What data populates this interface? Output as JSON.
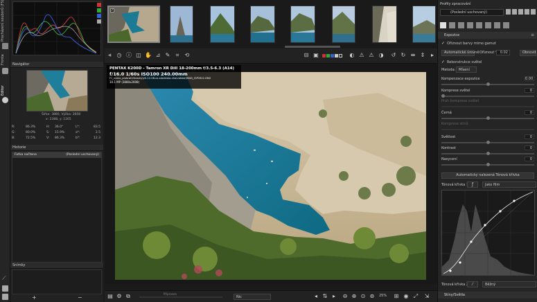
{
  "vtabs": {
    "tab1": "Procházení souborů (F5)",
    "tab2": "Fronta",
    "tab3": "Editor"
  },
  "navigator": {
    "title": "Navigátor",
    "size_text": "Šířka: 3880, Výška: 2608",
    "coords_text": "x: 2388, y: 1165",
    "rows": [
      {
        "l1": "R:",
        "v1": "86.3%",
        "l2": "H:",
        "v2": "36.0°",
        "l3": "L*:",
        "v3": "83.5"
      },
      {
        "l1": "G:",
        "v1": "80.0%",
        "l2": "S:",
        "v2": "15.9%",
        "l3": "a*:",
        "v3": "2.5"
      },
      {
        "l1": "B:",
        "v1": "72.5%",
        "l2": "V:",
        "v2": "86.3%",
        "l3": "b*:",
        "v3": "12.3"
      }
    ]
  },
  "history": {
    "title": "Historie",
    "col1": "Fotka načtena",
    "col2": "(Poslední uschovaný)"
  },
  "snapshots": {
    "title": "Snímky",
    "add": "+",
    "remove": "−"
  },
  "exif": {
    "line1": "PENTAX K200D - Tamron XR DiII 18-200mm f/3.5-6.3 (A14)",
    "line2": "f/16.0  1/60s  ISO100  240.00mm",
    "line3": "F:\\_nutno_probrat\\Obrazky\\20-12-08-xx-slovinsko-chorvatsko\\RAW\\_IGP2622.DNG",
    "line4": "10.1 MP (3880x2608)"
  },
  "bottombar": {
    "status": "Připraven",
    "select_value": "Nic",
    "zoom": "25%"
  },
  "rightpanel": {
    "profiles_title": "Profily zpracování",
    "profile_value": "(Poslední uschovaný)",
    "exposure_title": "Expozice",
    "clip_gamut": "Oříznout barvy mimo gamut",
    "auto_levels": "Automatické úrovně",
    "clip_label": "Oříznout %",
    "clip_value": "0.02",
    "neutral": "Obnovit",
    "highlight_recon": "Rekonstrukce světel",
    "method_label": "Metoda:",
    "method_value": "Mísení",
    "sliders": [
      {
        "label": "Kompenzace expozice",
        "value": "0.00",
        "pos": 0.5
      },
      {
        "label": "Komprese světel",
        "value": "0",
        "pos": 0.0
      },
      {
        "label": "Práh komprese světel",
        "value": "",
        "pos": 0.5
      },
      {
        "label": "Černá",
        "value": "0",
        "pos": 0.5
      },
      {
        "label": "Komprese stínů",
        "value": "",
        "pos": 0.5
      },
      {
        "label": "Světlost",
        "value": "0",
        "pos": 0.5
      },
      {
        "label": "Kontrast",
        "value": "0",
        "pos": 0.5
      },
      {
        "label": "Nasycení",
        "value": "0",
        "pos": 0.5
      }
    ],
    "auto_curve_btn": "Automaticky nalezená Tónová křivka",
    "curve1_label": "Tónová křivka 1:",
    "curve1_type": "Jako film",
    "curve2_label": "Tónová křivka 2:",
    "curve2_type": "Běžný",
    "shadows_title": "Stíny/Světla"
  }
}
